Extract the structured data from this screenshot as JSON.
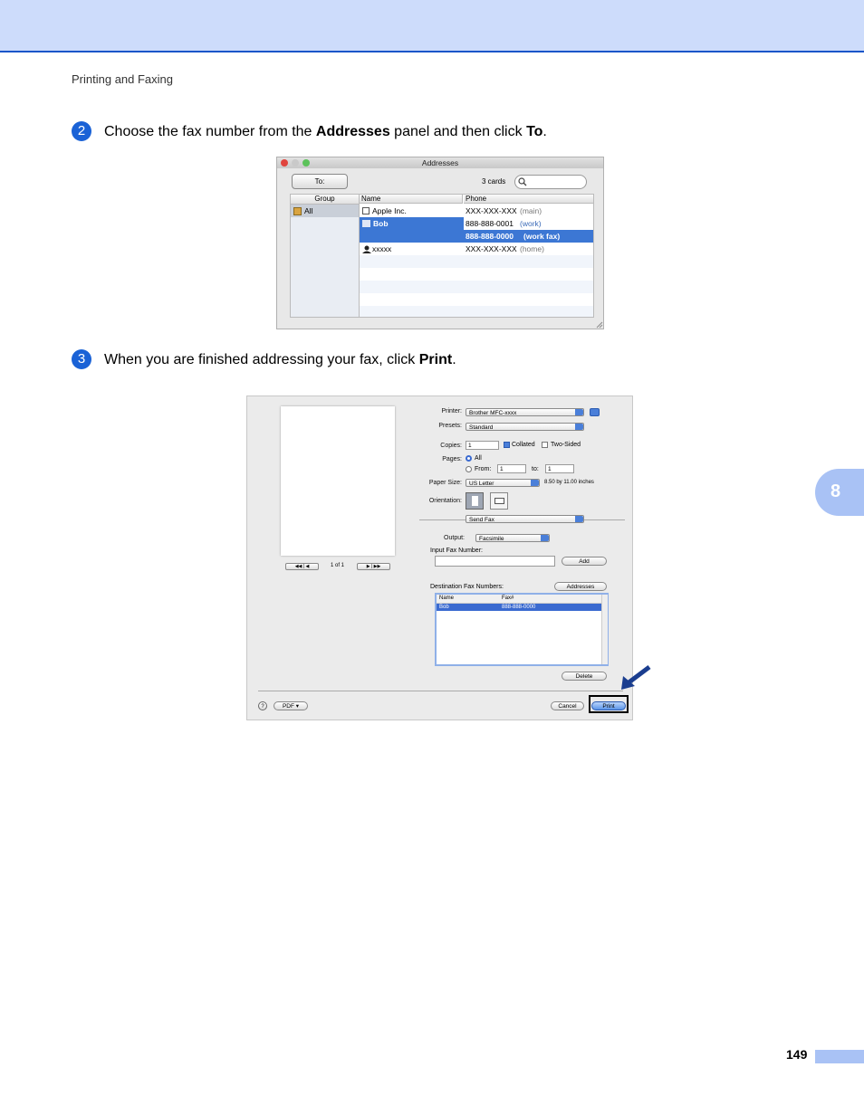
{
  "header": {
    "section": "Printing and Faxing"
  },
  "steps": [
    {
      "number": "2",
      "parts": [
        "Choose the fax number from the ",
        "Addresses",
        " panel and then click ",
        "To",
        "."
      ]
    },
    {
      "number": "3",
      "parts": [
        "When you are finished addressing your fax, click ",
        "Print",
        "."
      ]
    }
  ],
  "addresses_window": {
    "title": "Addresses",
    "to_button": "To:",
    "card_count": "3 cards",
    "group_header": "Group",
    "name_header": "Name",
    "phone_header": "Phone",
    "group_all": "All",
    "rows": [
      {
        "name": "Apple Inc.",
        "phone": "XXX-XXX-XXX",
        "type": "(main)"
      },
      {
        "name": "Bob",
        "phone": "888-888-0001",
        "type": "(work)"
      },
      {
        "name": "",
        "phone": "888-888-0000",
        "type": "(work fax)"
      },
      {
        "name": "xxxxx",
        "phone": "XXX-XXX-XXX",
        "type": "(home)"
      }
    ]
  },
  "print_dialog": {
    "printer_label": "Printer:",
    "printer_value": "Brother MFC-xxxx",
    "presets_label": "Presets:",
    "presets_value": "Standard",
    "copies_label": "Copies:",
    "copies_value": "1",
    "collated_label": "Collated",
    "two_sided_label": "Two-Sided",
    "pages_label": "Pages:",
    "all_label": "All",
    "from_label": "From:",
    "from_value": "1",
    "to_label": "to:",
    "to_value": "1",
    "paper_size_label": "Paper Size:",
    "paper_size_value": "US Letter",
    "paper_dims": "8.50 by 11.00 inches",
    "orientation_label": "Orientation:",
    "section_popup": "Send Fax",
    "output_label": "Output:",
    "output_value": "Facsimile",
    "input_fax_label": "Input Fax Number:",
    "add_button": "Add",
    "dest_label": "Destination Fax Numbers:",
    "addresses_button": "Addresses",
    "dest_name_header": "Name",
    "dest_fax_header": "Fax#",
    "dest_rows": [
      {
        "name": "Bob",
        "fax": "888-888-0000"
      }
    ],
    "delete_button": "Delete",
    "page_indicator": "1 of 1",
    "pdf_button": "PDF ▾",
    "cancel_button": "Cancel",
    "print_button": "Print"
  },
  "chapter_tab": "8",
  "page_number": "149"
}
